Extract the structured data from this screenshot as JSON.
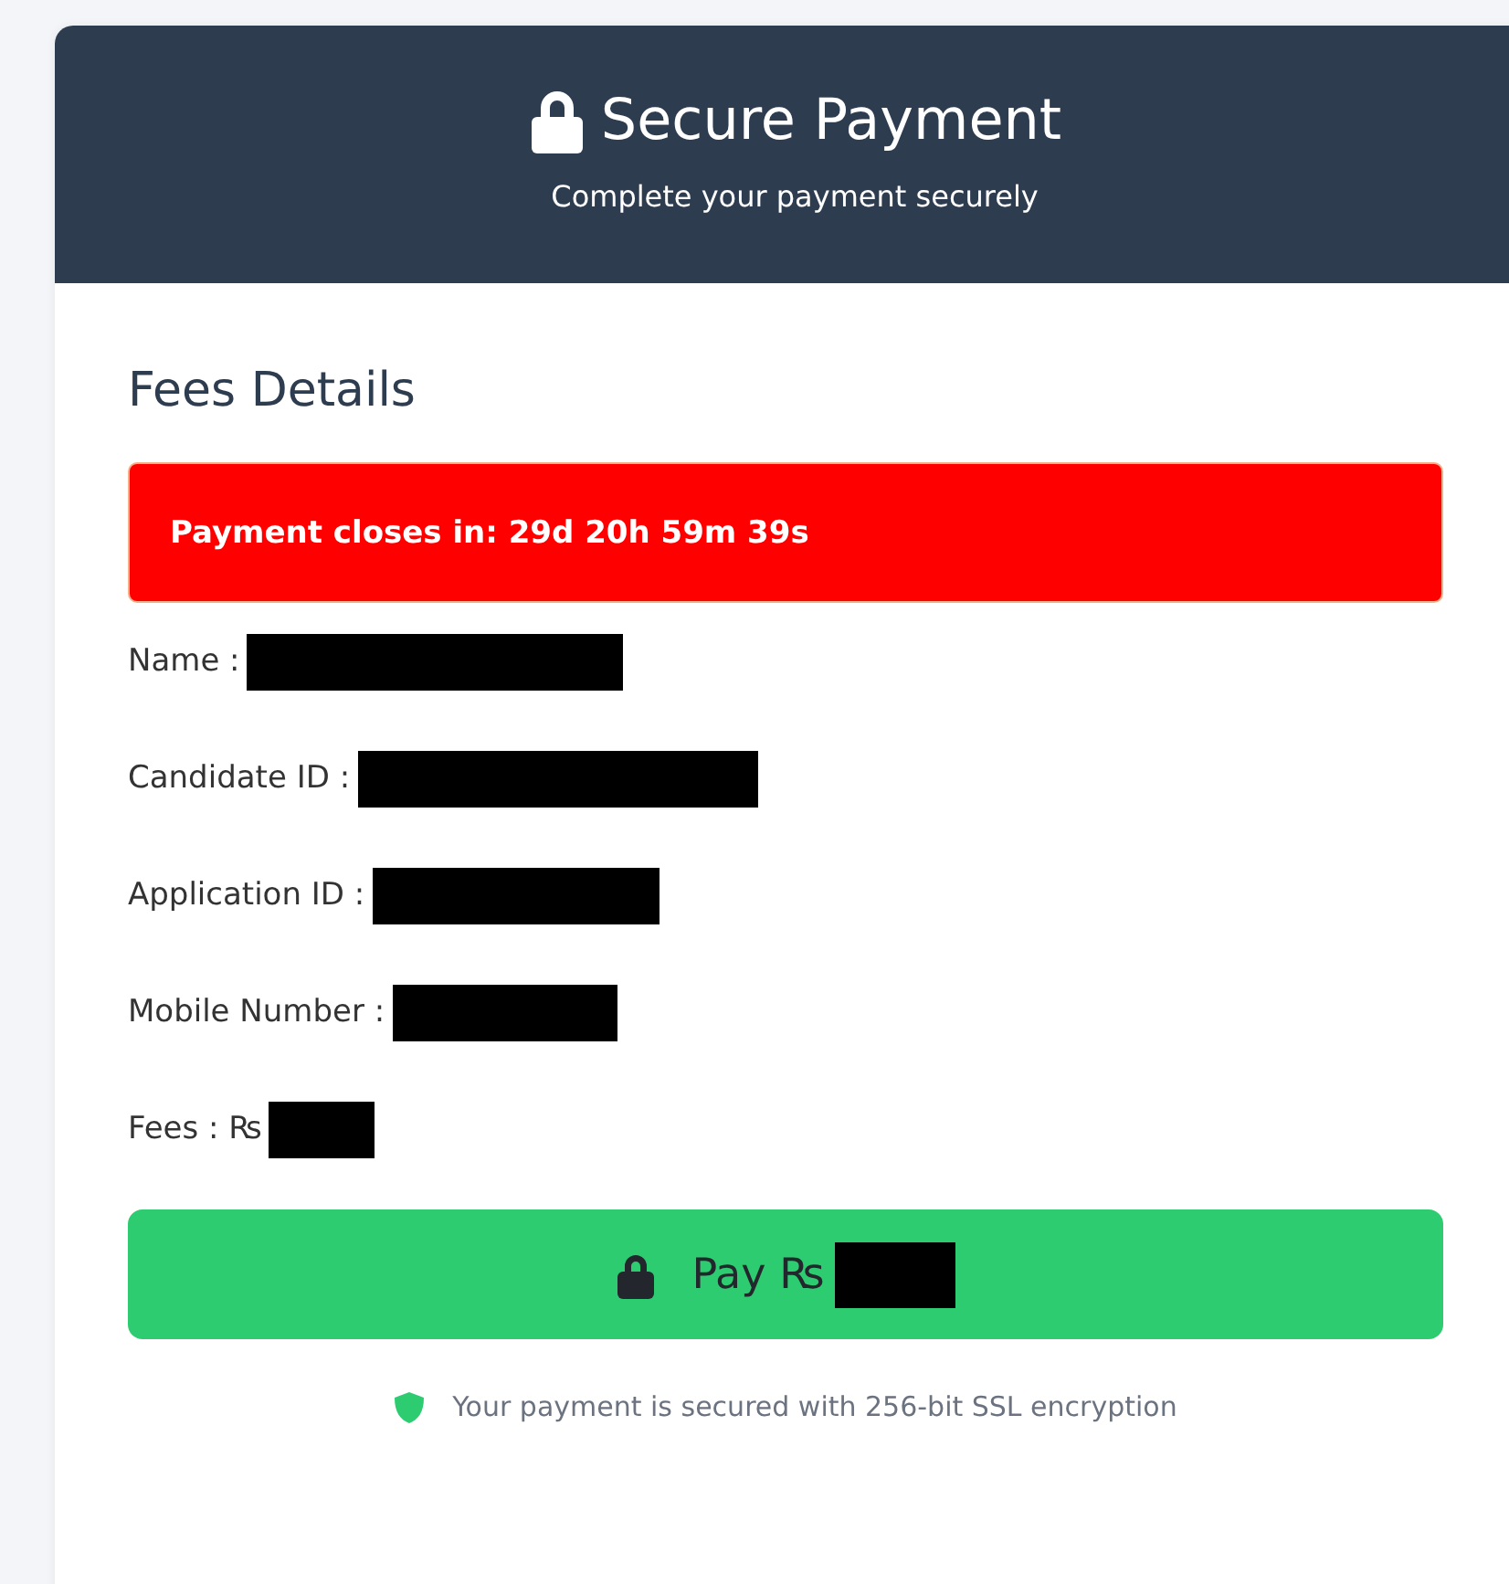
{
  "header": {
    "title": "Secure Payment",
    "subtitle": "Complete your payment securely"
  },
  "section_title": "Fees Details",
  "countdown": {
    "text": "Payment closes in: 29d 20h 59m 39s"
  },
  "fields": [
    {
      "label": "Name :",
      "redacted": true
    },
    {
      "label": "Candidate ID :",
      "redacted": true
    },
    {
      "label": "Application ID :",
      "redacted": true
    },
    {
      "label": "Mobile Number :",
      "redacted": true
    },
    {
      "label": "Fees : ₨",
      "redacted": true
    }
  ],
  "pay_button": {
    "label": "Pay ₨",
    "redacted": true
  },
  "security_note": "Your payment is secured with 256-bit SSL encryption"
}
